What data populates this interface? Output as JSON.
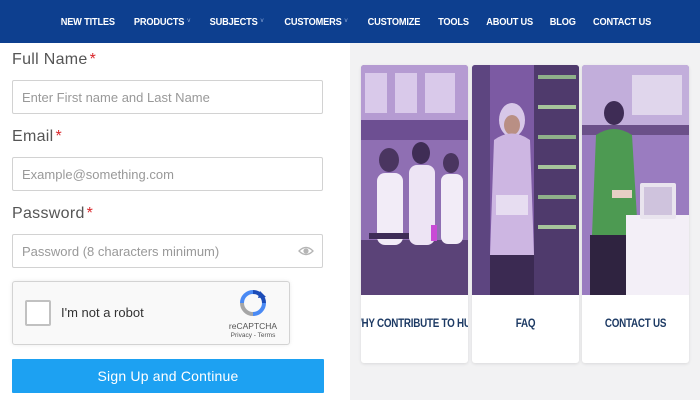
{
  "nav": {
    "items": [
      {
        "label": "NEW TITLES",
        "dropdown": false
      },
      {
        "label": "PRODUCTS",
        "dropdown": true
      },
      {
        "label": "SUBJECTS",
        "dropdown": true
      },
      {
        "label": "CUSTOMERS",
        "dropdown": true
      },
      {
        "label": "CUSTOMIZE",
        "dropdown": false
      },
      {
        "label": "TOOLS",
        "dropdown": false
      },
      {
        "label": "ABOUT US",
        "dropdown": false
      },
      {
        "label": "BLOG",
        "dropdown": false
      },
      {
        "label": "CONTACT US",
        "dropdown": false
      }
    ],
    "caret": "˅"
  },
  "form": {
    "full_name": {
      "label": "Full Name",
      "required": "*",
      "placeholder": "Enter First name and Last Name"
    },
    "email": {
      "label": "Email",
      "required": "*",
      "placeholder": "Example@something.com"
    },
    "password": {
      "label": "Password",
      "required": "*",
      "placeholder": "Password (8 characters minimum)",
      "icon": "eye-icon"
    },
    "captcha": {
      "text": "I'm not a robot",
      "brand": "reCAPTCHA",
      "links": "Privacy - Terms"
    },
    "submit_label": "Sign Up and Continue"
  },
  "cards": [
    {
      "title": "WHY CONTRIBUTE TO HU?"
    },
    {
      "title": "FAQ"
    },
    {
      "title": "CONTACT US"
    }
  ],
  "colors": {
    "nav_bg": "#0d3f8f",
    "submit_bg": "#1da1f2",
    "required": "#d9252a",
    "card_title": "#1d3a64",
    "photo_tint": "#a477c8"
  }
}
